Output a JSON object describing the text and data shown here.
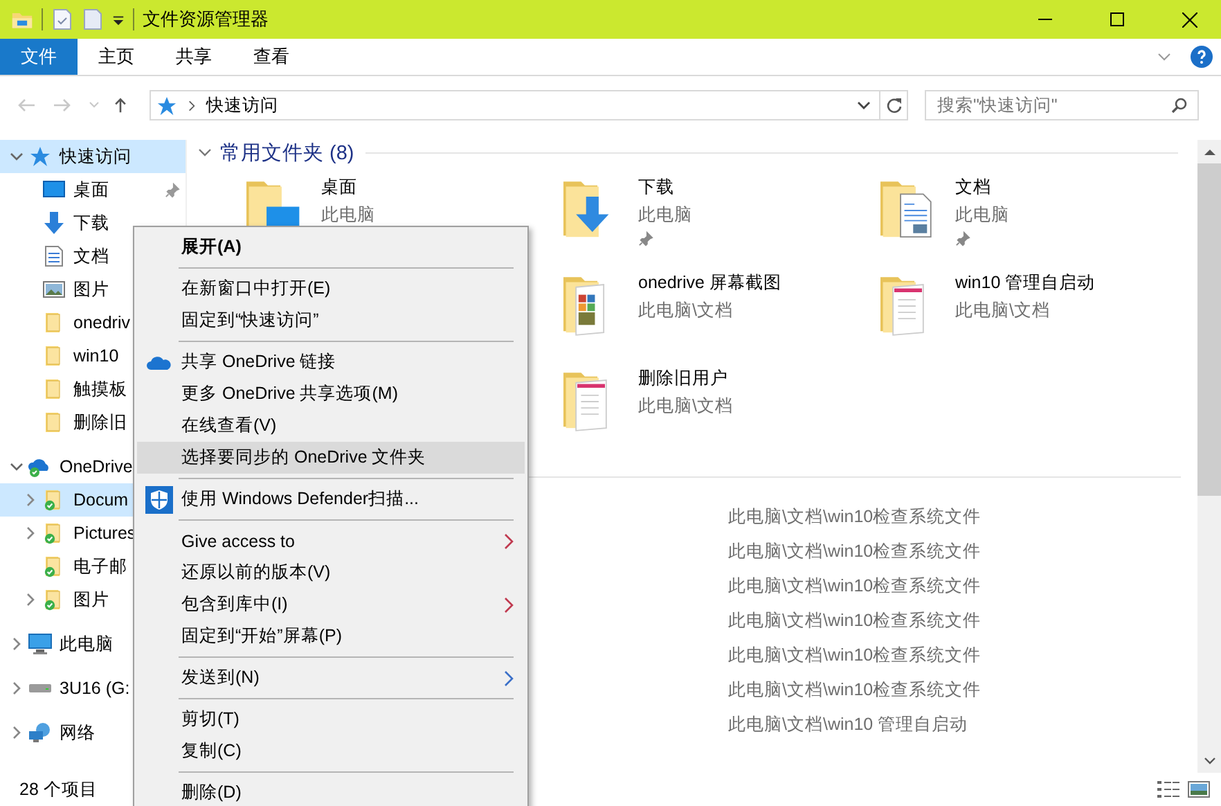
{
  "window": {
    "title": "文件资源管理器"
  },
  "ribbon_tabs": [
    {
      "label": "文件",
      "kind": "file"
    },
    {
      "label": "主页",
      "kind": "tab"
    },
    {
      "label": "共享",
      "kind": "tab"
    },
    {
      "label": "查看",
      "kind": "tab"
    }
  ],
  "address": {
    "path": "快速访问"
  },
  "search": {
    "placeholder": "搜索\"快速访问\""
  },
  "sidebar": {
    "items": [
      {
        "label": "快速访问",
        "kind": "quick",
        "expanded": true,
        "selected": true,
        "children": [
          {
            "label": "桌面",
            "kind": "desktop",
            "pinned": true,
            "selected": false
          },
          {
            "label": "下载",
            "kind": "download",
            "selected": false
          },
          {
            "label": "文档",
            "kind": "document",
            "selected": false
          },
          {
            "label": "图片",
            "kind": "pictures",
            "selected": false
          },
          {
            "label": "onedriv",
            "kind": "folder",
            "selected": false
          },
          {
            "label": "win10",
            "kind": "folder",
            "selected": false
          },
          {
            "label": "触摸板",
            "kind": "folder",
            "selected": false
          },
          {
            "label": "删除旧",
            "kind": "folder",
            "selected": false
          }
        ]
      },
      {
        "label": "OneDrive",
        "kind": "cloud",
        "expanded": true,
        "selected": false,
        "children": [
          {
            "label": "Docum",
            "kind": "folder",
            "synced": true,
            "expanded": false,
            "selected": true
          },
          {
            "label": "Pictures",
            "kind": "folder",
            "synced": true,
            "expanded": false,
            "selected": false
          },
          {
            "label": "电子邮",
            "kind": "folder",
            "synced": true,
            "selected": false
          },
          {
            "label": "图片",
            "kind": "folder",
            "synced": true,
            "expanded": false,
            "selected": false
          }
        ]
      },
      {
        "label": "此电脑",
        "kind": "pc",
        "expanded": false,
        "selected": false
      },
      {
        "label": "3U16 (G:",
        "kind": "drive",
        "expanded": false,
        "selected": false
      },
      {
        "label": "网络",
        "kind": "network",
        "expanded": false,
        "selected": false
      }
    ]
  },
  "frequent": {
    "title": "常用文件夹 (8)",
    "tiles": [
      {
        "name": "桌面",
        "location": "此电脑",
        "kind": "desktop"
      },
      {
        "name": "下载",
        "location": "此电脑",
        "kind": "download",
        "pinned": true
      },
      {
        "name": "文档",
        "location": "此电脑",
        "kind": "document",
        "pinned": true
      },
      {
        "name": "onedrive 屏幕截图",
        "location": "此电脑\\文档",
        "kind": "tiles"
      },
      {
        "name": "win10 管理自启动",
        "location": "此电脑\\文档",
        "kind": "pages"
      },
      {
        "name": "删除旧用户",
        "location": "此电脑\\文档",
        "kind": "pages"
      }
    ]
  },
  "recent_files": [
    {
      "path": "此电脑\\文档\\win10检查系统文件"
    },
    {
      "path": "此电脑\\文档\\win10检查系统文件"
    },
    {
      "path": "此电脑\\文档\\win10检查系统文件"
    },
    {
      "path": "此电脑\\文档\\win10检查系统文件"
    },
    {
      "path": "此电脑\\文档\\win10检查系统文件"
    },
    {
      "path": "此电脑\\文档\\win10检查系统文件"
    },
    {
      "path": "此电脑\\文档\\win10 管理自启动"
    }
  ],
  "status_bar": {
    "count": "28 个项目"
  },
  "context_menu": [
    {
      "kind": "item",
      "label": "展开(A)",
      "bold": true
    },
    {
      "kind": "separator"
    },
    {
      "kind": "item",
      "label": "在新窗口中打开(E)"
    },
    {
      "kind": "item",
      "label": "固定到“快速访问”"
    },
    {
      "kind": "separator"
    },
    {
      "kind": "onedrive",
      "label": "共享 OneDrive 链接"
    },
    {
      "kind": "item",
      "label": "更多 OneDrive 共享选项(M)"
    },
    {
      "kind": "item",
      "label": "在线查看(V)"
    },
    {
      "kind": "item",
      "label": "选择要同步的 OneDrive 文件夹",
      "highlighted": true
    },
    {
      "kind": "separator"
    },
    {
      "kind": "defender",
      "label": "使用 Windows Defender扫描..."
    },
    {
      "kind": "separator"
    },
    {
      "kind": "item",
      "label": "Give access to",
      "submenu": true
    },
    {
      "kind": "item",
      "label": "还原以前的版本(V)"
    },
    {
      "kind": "item",
      "label": "包含到库中(I)",
      "submenu": true
    },
    {
      "kind": "item",
      "label": "固定到“开始”屏幕(P)"
    },
    {
      "kind": "separator"
    },
    {
      "kind": "item",
      "label": "发送到(N)",
      "submenu": true
    },
    {
      "kind": "separator"
    },
    {
      "kind": "item",
      "label": "剪切(T)"
    },
    {
      "kind": "item",
      "label": "复制(C)"
    },
    {
      "kind": "separator"
    },
    {
      "kind": "item",
      "label": "删除(D)"
    }
  ]
}
